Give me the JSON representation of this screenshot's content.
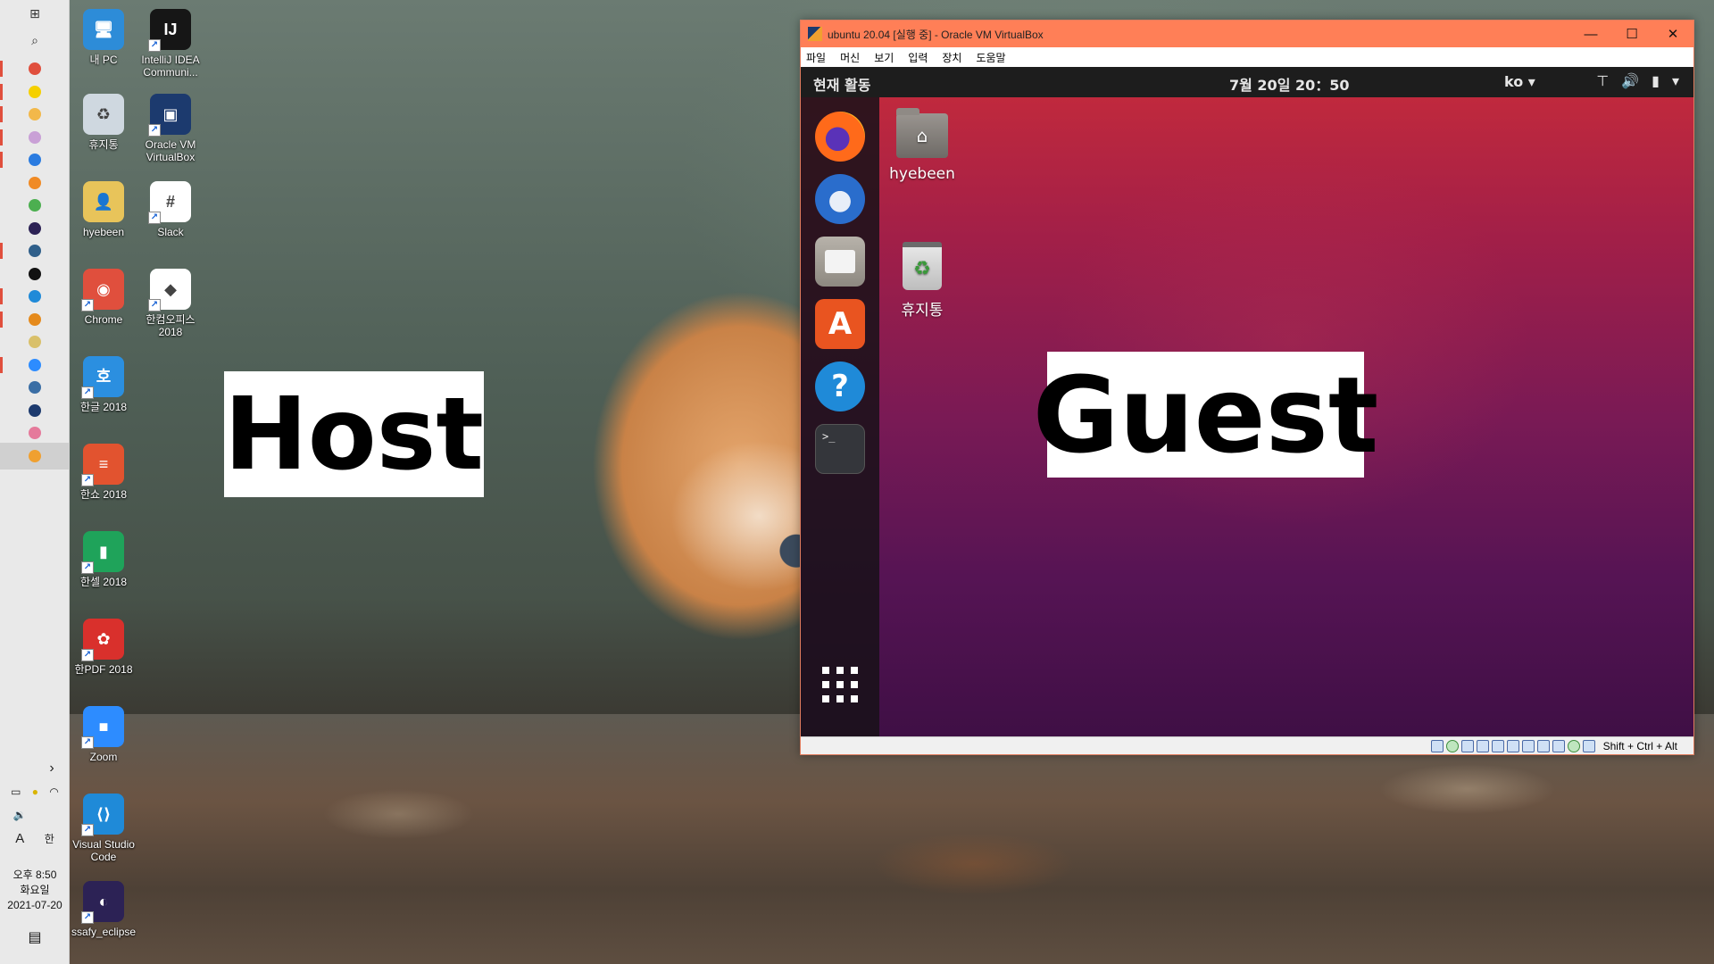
{
  "labels": {
    "host": "Host",
    "guest": "Guest"
  },
  "taskbar": {
    "items": [
      {
        "name": "windows-start-icon",
        "glyph": "⊞"
      },
      {
        "name": "search-icon",
        "glyph": "⌕"
      },
      {
        "name": "chrome-taskbar-icon",
        "color": "#e04f3d"
      },
      {
        "name": "kakaotalk-taskbar-icon",
        "color": "#f5d000"
      },
      {
        "name": "file-explorer-taskbar-icon",
        "color": "#f2b84a"
      },
      {
        "name": "paint-taskbar-icon",
        "color": "#c9a0d6"
      },
      {
        "name": "app-blue-taskbar-icon",
        "color": "#2a7be0"
      },
      {
        "name": "sublime-taskbar-icon",
        "color": "#f08a24"
      },
      {
        "name": "app-green-taskbar-icon",
        "color": "#4caf50"
      },
      {
        "name": "eclipse-taskbar-icon",
        "color": "#2c2255"
      },
      {
        "name": "app-terminal-taskbar-icon",
        "color": "#2f5f8a"
      },
      {
        "name": "intellij-taskbar-icon",
        "color": "#111111"
      },
      {
        "name": "vscode-taskbar-icon",
        "color": "#1f8ad8"
      },
      {
        "name": "app-key-taskbar-icon",
        "color": "#e58a1c"
      },
      {
        "name": "slack-taskbar-icon",
        "color": "#d9c06a"
      },
      {
        "name": "zoom-taskbar-icon",
        "color": "#2d8cff"
      },
      {
        "name": "app-people-taskbar-icon",
        "color": "#3a6ea5"
      },
      {
        "name": "virtualbox-taskbar-icon",
        "color": "#1c3a6e"
      },
      {
        "name": "app-colorful-taskbar-icon",
        "color": "#e57a9b"
      },
      {
        "name": "virtualbox-running-taskbar-icon",
        "color": "#f0a030"
      }
    ],
    "tray": {
      "chevron": "›",
      "lang_a": "A",
      "lang_han": "한"
    },
    "clock": {
      "time": "오후 8:50",
      "day": "화요일",
      "date": "2021-07-20"
    }
  },
  "desktop_icons": [
    {
      "key": "mypc",
      "label": "내 PC",
      "color": "#2d8cd8",
      "glyph": "🖥"
    },
    {
      "key": "intellij",
      "label": "IntelliJ IDEA Communi...",
      "color": "#161616",
      "glyph": "IJ"
    },
    {
      "key": "recycle",
      "label": "휴지통",
      "color": "#cfd8e0",
      "glyph": "♻"
    },
    {
      "key": "virtualbox",
      "label": "Oracle VM VirtualBox",
      "color": "#1c3a6e",
      "glyph": "▣"
    },
    {
      "key": "hyebeen",
      "label": "hyebeen",
      "color": "#e8c45a",
      "glyph": "👤"
    },
    {
      "key": "slack",
      "label": "Slack",
      "color": "#ffffff",
      "glyph": "#"
    },
    {
      "key": "chrome",
      "label": "Chrome",
      "color": "#e04f3d",
      "glyph": "◉"
    },
    {
      "key": "hancomoffice",
      "label": "한컴오피스 2018",
      "color": "#ffffff",
      "glyph": "◆"
    },
    {
      "key": "hangul",
      "label": "한글 2018",
      "color": "#2b8fe0",
      "glyph": "호"
    },
    {
      "key": "hanshow",
      "label": "한쇼 2018",
      "color": "#e2532f",
      "glyph": "≡"
    },
    {
      "key": "hancell",
      "label": "한셀 2018",
      "color": "#1fa35a",
      "glyph": "▮"
    },
    {
      "key": "hanpdf",
      "label": "한PDF 2018",
      "color": "#d9302c",
      "glyph": "✿"
    },
    {
      "key": "zoom",
      "label": "Zoom",
      "color": "#2d8cff",
      "glyph": "■"
    },
    {
      "key": "vscode",
      "label": "Visual Studio Code",
      "color": "#1f8ad8",
      "glyph": "⟨⟩"
    },
    {
      "key": "eclipse",
      "label": "ssafy_eclipse",
      "color": "#2c2255",
      "glyph": "◐"
    }
  ],
  "vbox": {
    "title": "ubuntu 20.04 [실행 중] - Oracle VM VirtualBox",
    "controls": {
      "minimize": "—",
      "maximize": "☐",
      "close": "✕"
    },
    "menu": [
      "파일",
      "머신",
      "보기",
      "입력",
      "장치",
      "도움말"
    ],
    "host_key": "Shift + Ctrl + Alt"
  },
  "ubuntu": {
    "activities": "현재 활동",
    "datetime": "7월 20일  20：50",
    "language": "ko ▾",
    "system_icons": [
      "⊤",
      "🔊",
      "▮",
      "▾"
    ],
    "dock": [
      "firefox",
      "thunderbird",
      "files",
      "software",
      "help",
      "terminal"
    ],
    "terminal_prompt": ">_",
    "store_glyph": "A",
    "help_glyph": "?",
    "desktop_icons": [
      {
        "label": "hyebeen",
        "glyph": "⌂"
      },
      {
        "label": "휴지통",
        "glyph": "♻"
      }
    ]
  }
}
